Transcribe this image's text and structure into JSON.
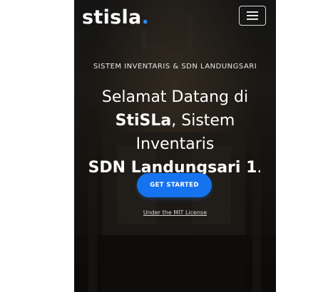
{
  "navbar": {
    "brand": "stisla",
    "brand_dot": ".",
    "menu_icon": "hamburger-menu-icon"
  },
  "hero": {
    "subtitle": "SISTEM INVENTARIS & SDN LANDUNGSARI",
    "welcome_line1": "Selamat Datang di",
    "welcome_brand": "StiSLa",
    "welcome_line2_rest": ", Sistem Inventaris",
    "welcome_school": "SDN Landungsari 1",
    "welcome_end": ".",
    "cta_label": "GET STARTED",
    "license_link": "Under the MIT License"
  },
  "colors": {
    "accent": "#1673f0",
    "brand_dot": "#2f8cf0"
  }
}
